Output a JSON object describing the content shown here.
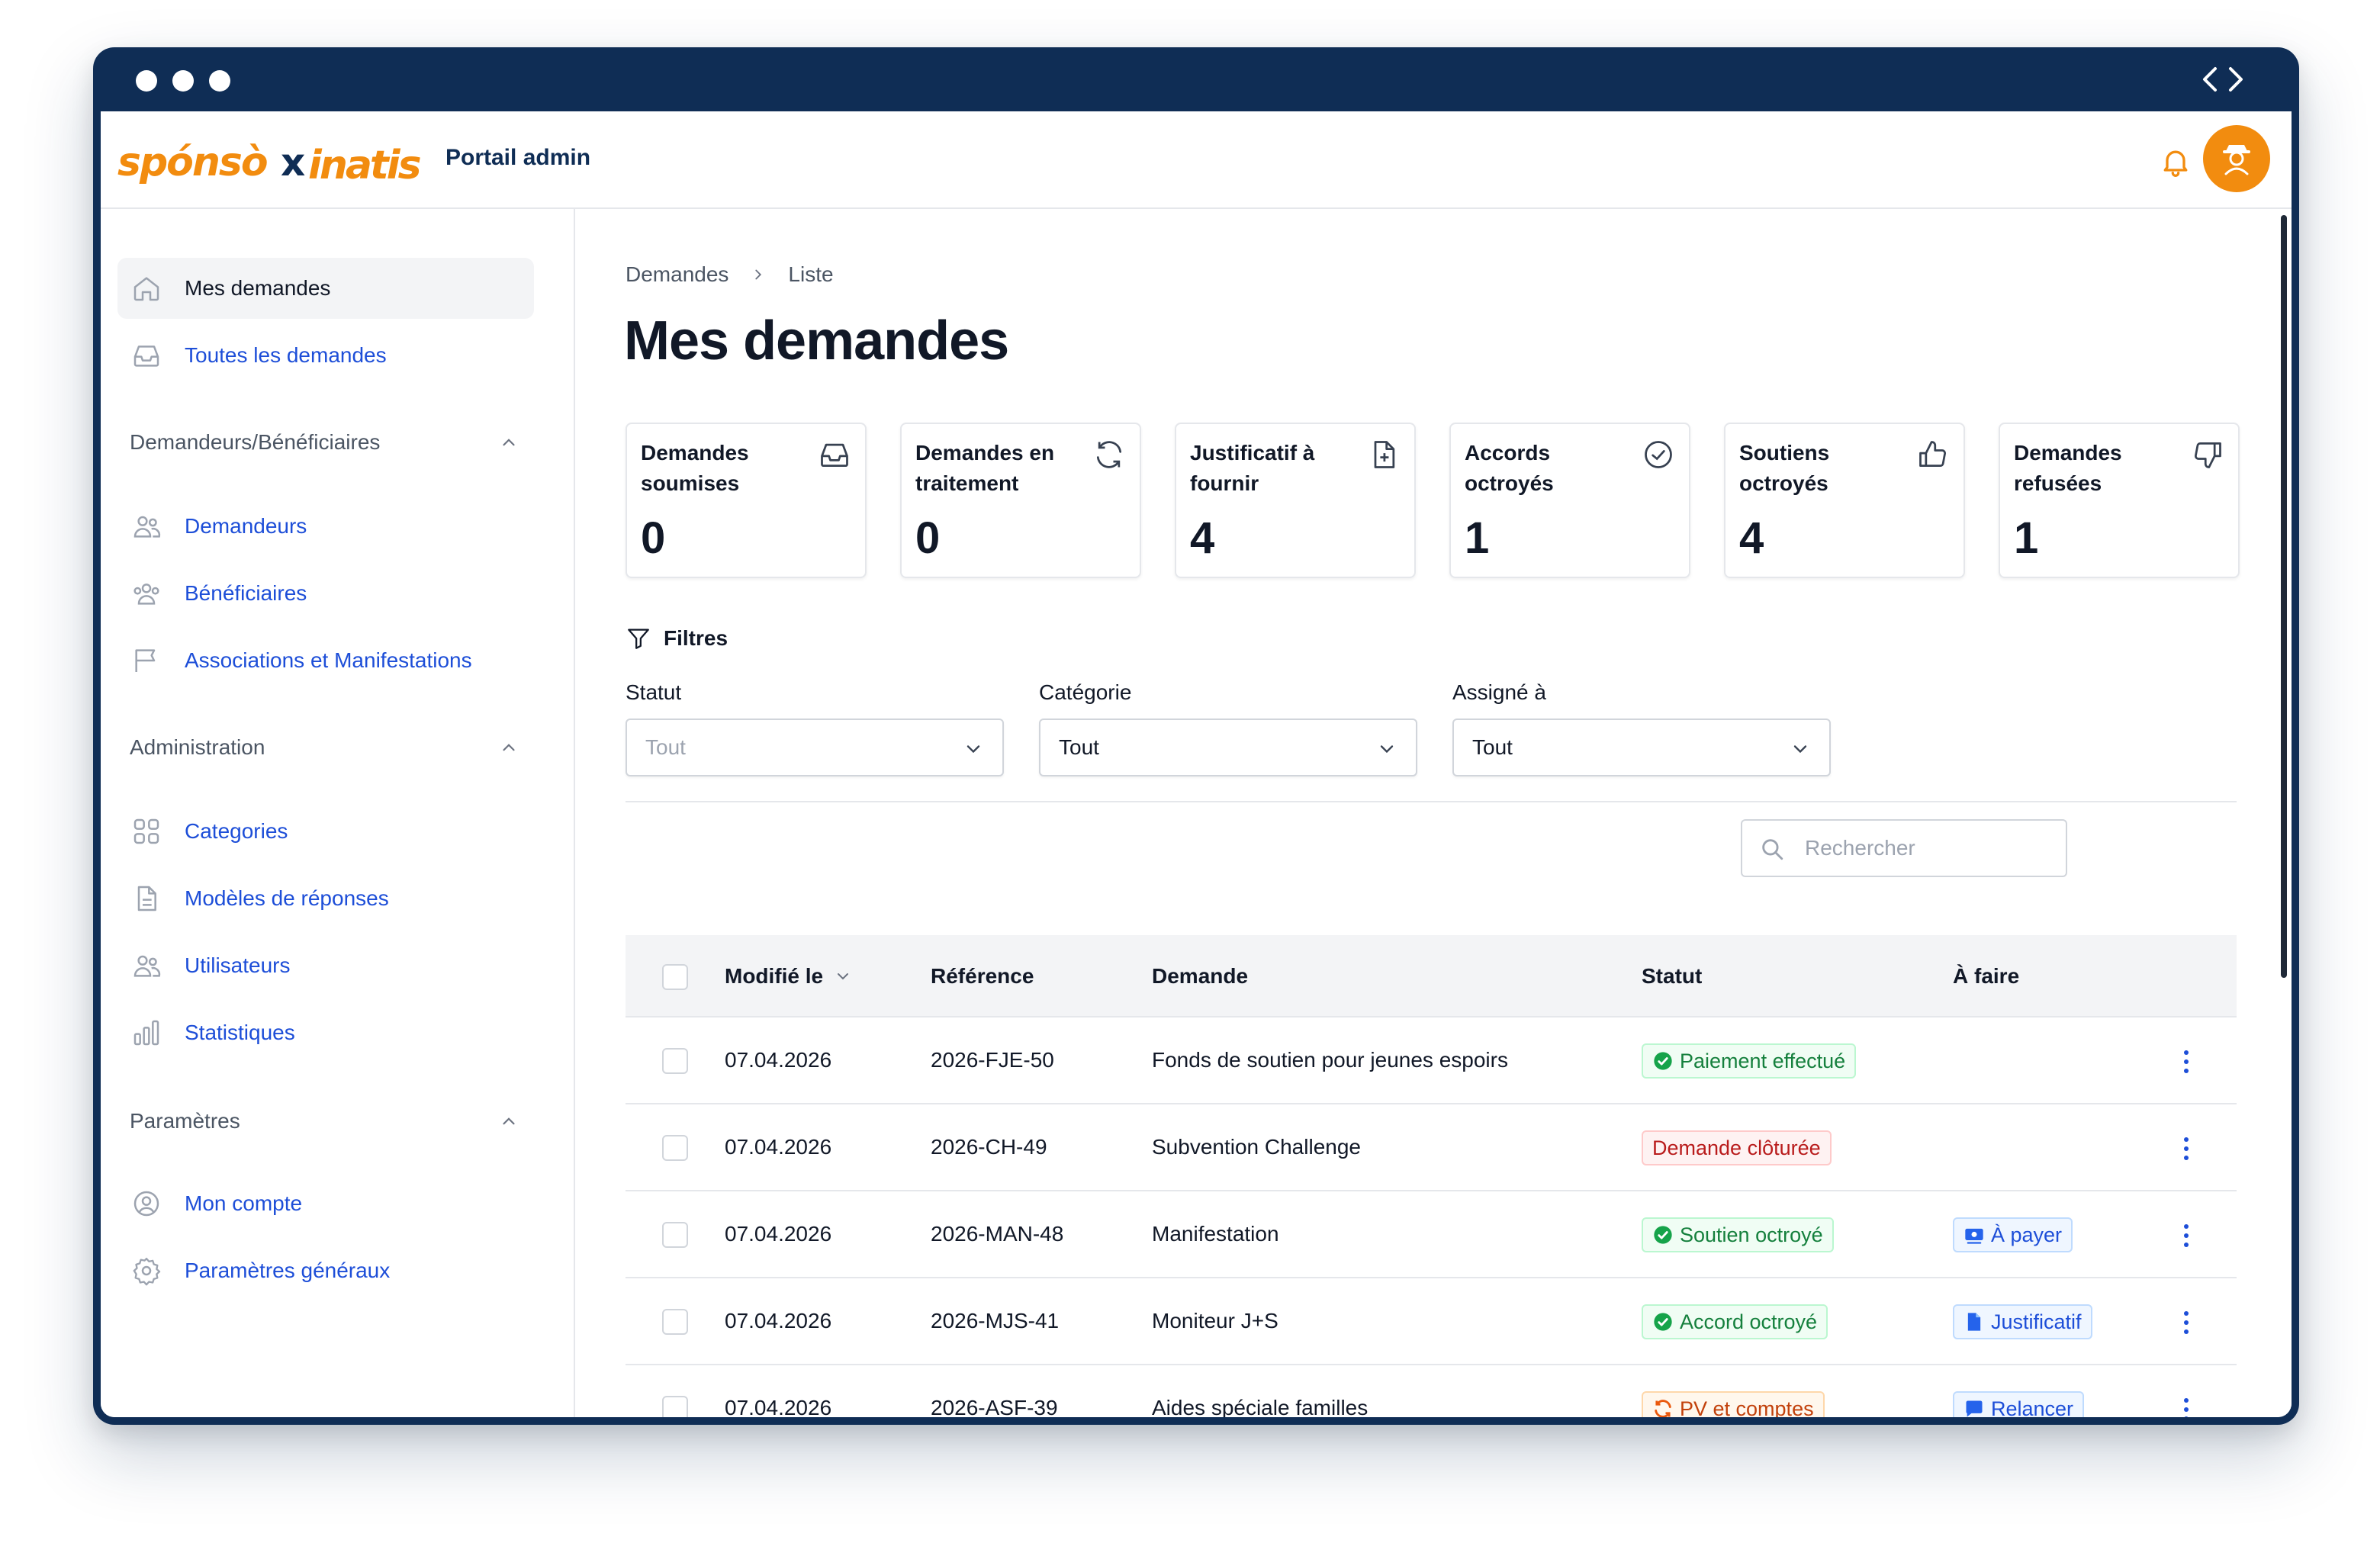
{
  "app": {
    "brand": "sponsoxinatis",
    "portal_label": "Portail admin",
    "colors": {
      "navy": "#0f2d55",
      "accent": "#f28c0f",
      "link": "#1d4ed8"
    }
  },
  "sidebar": {
    "items": [
      {
        "label": "Mes demandes",
        "icon": "home-icon",
        "active": true
      },
      {
        "label": "Toutes les demandes",
        "icon": "inbox-icon",
        "active": false
      }
    ],
    "sections": [
      {
        "title": "Demandeurs/Bénéficiaires",
        "items": [
          {
            "label": "Demandeurs",
            "icon": "users-icon"
          },
          {
            "label": "Bénéficiaires",
            "icon": "user-group-icon"
          },
          {
            "label": "Associations et Manifestations",
            "icon": "flag-icon"
          }
        ]
      },
      {
        "title": "Administration",
        "items": [
          {
            "label": "Categories",
            "icon": "grid-icon"
          },
          {
            "label": "Modèles de réponses",
            "icon": "document-icon"
          },
          {
            "label": "Utilisateurs",
            "icon": "users-icon"
          },
          {
            "label": "Statistiques",
            "icon": "bar-chart-icon"
          }
        ]
      },
      {
        "title": "Paramètres",
        "items": [
          {
            "label": "Mon compte",
            "icon": "user-circle-icon"
          },
          {
            "label": "Paramètres généraux",
            "icon": "gear-icon"
          }
        ]
      }
    ]
  },
  "breadcrumb": [
    "Demandes",
    "Liste"
  ],
  "page_title": "Mes demandes",
  "stats": [
    {
      "label": "Demandes soumises",
      "value": "0",
      "icon": "inbox-icon"
    },
    {
      "label": "Demandes en traitement",
      "value": "0",
      "icon": "refresh-icon"
    },
    {
      "label": "Justificatif à fournir",
      "value": "4",
      "icon": "document-plus-icon"
    },
    {
      "label": "Accords octroyés",
      "value": "1",
      "icon": "check-circle-icon"
    },
    {
      "label": "Soutiens octroyés",
      "value": "4",
      "icon": "thumb-up-icon"
    },
    {
      "label": "Demandes refusées",
      "value": "1",
      "icon": "thumb-down-icon"
    }
  ],
  "filters": {
    "title": "Filtres",
    "statut": {
      "label": "Statut",
      "value": "Tout"
    },
    "categorie": {
      "label": "Catégorie",
      "value": "Tout"
    },
    "assigne": {
      "label": "Assigné à",
      "value": "Tout"
    }
  },
  "search": {
    "placeholder": "Rechercher"
  },
  "table": {
    "columns": [
      "Modifié le",
      "Référence",
      "Demande",
      "Statut",
      "À faire"
    ],
    "rows": [
      {
        "date": "07.04.2026",
        "ref": "2026-FJE-50",
        "demande": "Fonds de soutien pour jeunes espoirs",
        "statut": "Paiement effectué",
        "statut_tone": "green",
        "statut_icon": "check-circle-icon",
        "todo": "",
        "todo_icon": ""
      },
      {
        "date": "07.04.2026",
        "ref": "2026-CH-49",
        "demande": "Subvention Challenge",
        "statut": "Demande clôturée",
        "statut_tone": "red",
        "statut_icon": "",
        "todo": "",
        "todo_icon": ""
      },
      {
        "date": "07.04.2026",
        "ref": "2026-MAN-48",
        "demande": "Manifestation",
        "statut": "Soutien octroyé",
        "statut_tone": "green",
        "statut_icon": "check-circle-icon",
        "todo": "À payer",
        "todo_icon": "money-icon"
      },
      {
        "date": "07.04.2026",
        "ref": "2026-MJS-41",
        "demande": "Moniteur J+S",
        "statut": "Accord octroyé",
        "statut_tone": "green",
        "statut_icon": "check-circle-icon",
        "todo": "Justificatif",
        "todo_icon": "document-icon"
      },
      {
        "date": "07.04.2026",
        "ref": "2026-ASF-39",
        "demande": "Aides spéciale familles",
        "statut": "PV et comptes",
        "statut_tone": "orange",
        "statut_icon": "refresh-icon",
        "todo": "Relancer",
        "todo_icon": "chat-icon"
      }
    ]
  }
}
